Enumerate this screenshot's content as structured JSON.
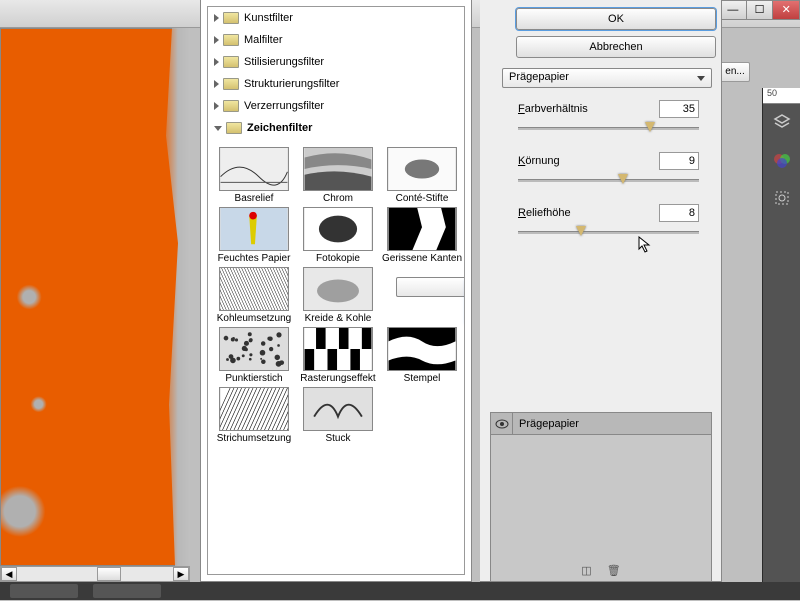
{
  "window": {
    "ok_label": "OK",
    "cancel_label": "Abbrechen",
    "close_x": "✕",
    "min": "—",
    "max": "☐",
    "settings": "en..."
  },
  "categories": [
    {
      "label": "Kunstfilter",
      "open": false
    },
    {
      "label": "Malfilter",
      "open": false
    },
    {
      "label": "Stilisierungsfilter",
      "open": false
    },
    {
      "label": "Strukturierungsfilter",
      "open": false
    },
    {
      "label": "Verzerrungsfilter",
      "open": false
    },
    {
      "label": "Zeichenfilter",
      "open": true
    }
  ],
  "filters": [
    "Basrelief",
    "Chrom",
    "Conté-Stifte",
    "Feuchtes Papier",
    "Fotokopie",
    "Gerissene Kanten",
    "Kohleumsetzung",
    "Kreide & Kohle",
    "Prägepapier",
    "Punktierstich",
    "Rasterungseffekt",
    "Stempel",
    "Strichumsetzung",
    "Stuck"
  ],
  "selected_filter": "Prägepapier",
  "effect_dropdown": "Prägepapier",
  "params": [
    {
      "label": "Farbverhältnis",
      "underline": "F",
      "value": 35,
      "pos": 70
    },
    {
      "label": "Körnung",
      "underline": "K",
      "value": 9,
      "pos": 55
    },
    {
      "label": "Reliefhöhe",
      "underline": "R",
      "value": 8,
      "pos": 32
    }
  ],
  "layer": {
    "name": "Prägepapier",
    "new_icon": "◫",
    "trash_icon": "🗑"
  },
  "ruler": "50",
  "scroll": {
    "left": "◀",
    "right": "▶"
  },
  "collapse_icon": "«"
}
